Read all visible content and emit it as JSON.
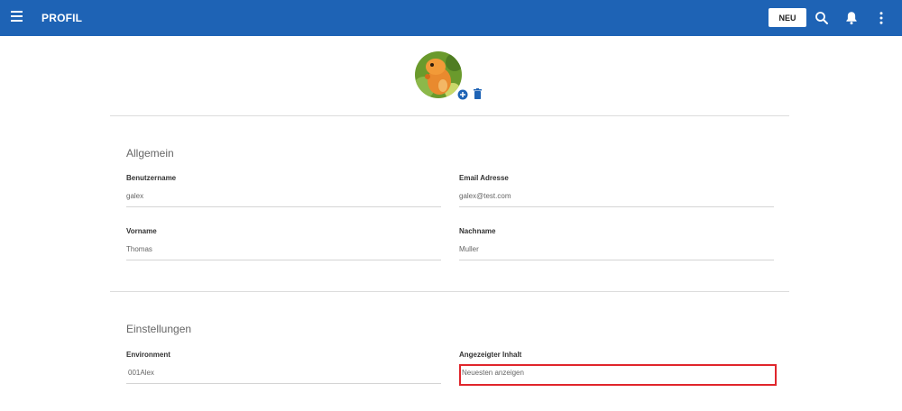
{
  "header": {
    "title": "PROFIL",
    "new_button": "NEU",
    "icons": [
      "menu-icon",
      "search-icon",
      "bell-icon",
      "more-vert-icon"
    ]
  },
  "profile": {
    "avatar_icons": [
      "add-circle-icon",
      "trash-icon"
    ]
  },
  "general": {
    "section_title": "Allgemein",
    "username_label": "Benutzername",
    "username_value": "galex",
    "email_label": "Email Adresse",
    "email_value": "galex@test.com",
    "firstname_label": "Vorname",
    "firstname_value": "Thomas",
    "lastname_label": "Nachname",
    "lastname_value": "Muller"
  },
  "settings": {
    "section_title": "Einstellungen",
    "environment_label": "Environment",
    "environment_value": "001Alex",
    "content_label": "Angezeigter Inhalt",
    "content_value": "Neuesten anzeigen"
  },
  "colors": {
    "header_bg": "#1e63b5",
    "highlight": "#e0262c"
  }
}
